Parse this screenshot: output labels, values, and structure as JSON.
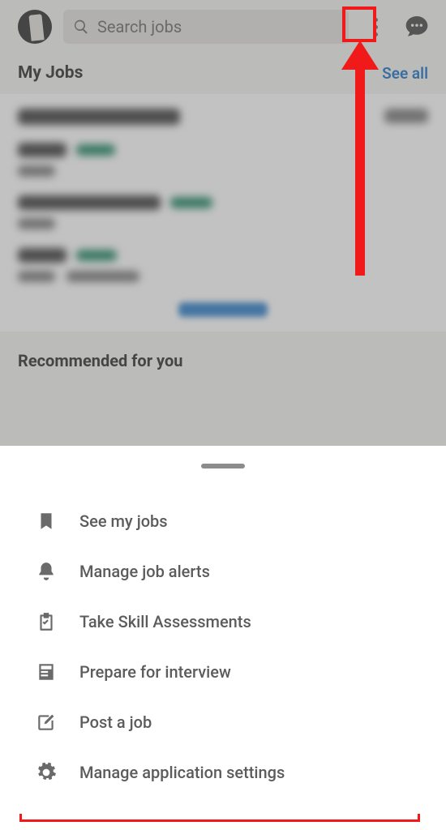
{
  "topbar": {
    "search_placeholder": "Search jobs"
  },
  "myJobs": {
    "title": "My Jobs",
    "see_all": "See all"
  },
  "recommended": {
    "title": "Recommended for you"
  },
  "sheet": {
    "items": [
      {
        "label": "See my jobs"
      },
      {
        "label": "Manage job alerts"
      },
      {
        "label": "Take Skill Assessments"
      },
      {
        "label": "Prepare for interview"
      },
      {
        "label": "Post a job"
      },
      {
        "label": "Manage application settings"
      }
    ]
  }
}
